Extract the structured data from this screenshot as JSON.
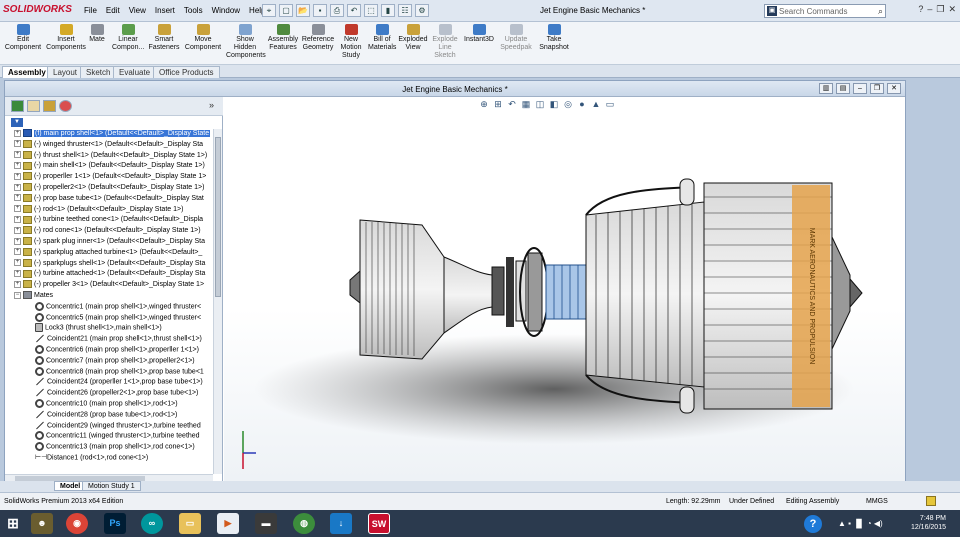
{
  "app": {
    "logo_text": "SOLIDWORKS",
    "document_title": "Jet Engine Basic Mechanics *",
    "search_placeholder": "Search Commands",
    "accent": "#c8102e"
  },
  "menu": [
    "File",
    "Edit",
    "View",
    "Insert",
    "Tools",
    "Window",
    "Help"
  ],
  "quick_access_icons": [
    "pin-icon",
    "new-document-icon",
    "open-icon",
    "save-icon",
    "print-icon",
    "undo-icon",
    "select-icon",
    "rebuild-icon",
    "file-properties-icon",
    "options-icon"
  ],
  "ribbon": [
    {
      "label": "Edit\nComponent",
      "icon": "edit-component-icon",
      "color": "#3e7bc7"
    },
    {
      "label": "Insert\nComponents",
      "icon": "insert-components-icon",
      "color": "#d4a926"
    },
    {
      "label": "Mate",
      "icon": "mate-icon",
      "color": "#8a8f99"
    },
    {
      "label": "Linear\nCompon...",
      "icon": "linear-pattern-icon",
      "color": "#5c9d4b"
    },
    {
      "label": "Smart\nFasteners",
      "icon": "smart-fasteners-icon",
      "color": "#c9a13a"
    },
    {
      "label": "Move\nComponent",
      "icon": "move-component-icon",
      "color": "#c9a13a"
    },
    {
      "label": "Show\nHidden\nComponents",
      "icon": "show-hidden-icon",
      "color": "#7fa3cf"
    },
    {
      "label": "Assembly\nFeatures",
      "icon": "assembly-features-icon",
      "color": "#4f8a3e"
    },
    {
      "label": "Reference\nGeometry",
      "icon": "reference-geometry-icon",
      "color": "#8a8f99"
    },
    {
      "label": "New\nMotion\nStudy",
      "icon": "motion-study-icon",
      "color": "#c0392b"
    },
    {
      "label": "Bill of\nMaterials",
      "icon": "bom-icon",
      "color": "#3e7bc7"
    },
    {
      "label": "Exploded\nView",
      "icon": "exploded-view-icon",
      "color": "#c9a13a"
    },
    {
      "label": "Explode\nLine\nSketch",
      "icon": "explode-line-icon",
      "color": "#b8c0cc"
    },
    {
      "label": "Instant3D",
      "icon": "instant3d-icon",
      "color": "#3e7bc7"
    },
    {
      "label": "Update\nSpeedpak",
      "icon": "speedpak-icon",
      "color": "#b8c0cc"
    },
    {
      "label": "Take\nSnapshot",
      "icon": "snapshot-icon",
      "color": "#3e7bc7"
    }
  ],
  "command_tabs": [
    "Assembly",
    "Layout",
    "Sketch",
    "Evaluate",
    "Office Products"
  ],
  "tree": {
    "components": [
      "(f) main prop shell<1> (Default<<Default>_Display State",
      "(-) winged thruster<1> (Default<<Default>_Display Sta",
      "(-) thrust shell<1> (Default<<Default>_Display State 1>)",
      "(-) main shell<1> (Default<<Default>_Display State 1>)",
      "(-) properller 1<1> (Default<<Default>_Display State 1>",
      "(-) propeller2<1> (Default<<Default>_Display State 1>)",
      "(-) prop base tube<1> (Default<<Default>_Display Stat",
      "(-) rod<1> (Default<<Default>_Display State 1>)",
      "(-) turbine teethed cone<1> (Default<<Default>_Displa",
      "(-) rod cone<1> (Default<<Default>_Display State 1>)",
      "(-) spark plug inner<1> (Default<<Default>_Display Sta",
      "(-) sparkplug attached turbine<1> (Default<<Default>_",
      "(-) sparkplugs shell<1> (Default<<Default>_Display Sta",
      "(-) turbine attached<1> (Default<<Default>_Display Sta",
      "(-) propeller 3<1> (Default<<Default>_Display State 1>"
    ],
    "mates_label": "Mates",
    "mates": [
      {
        "type": "concentric",
        "text": "Concentric1 (main prop shell<1>,winged thruster<"
      },
      {
        "type": "concentric",
        "text": "Concentric5 (main prop shell<1>,winged thruster<"
      },
      {
        "type": "lock",
        "text": "Lock3 (thrust shell<1>,main shell<1>)"
      },
      {
        "type": "coincident",
        "text": "Coincident21 (main prop shell<1>,thrust shell<1>)"
      },
      {
        "type": "concentric",
        "text": "Concentric6 (main prop shell<1>,properller 1<1>)"
      },
      {
        "type": "concentric",
        "text": "Concentric7 (main prop shell<1>,propeller2<1>)"
      },
      {
        "type": "concentric",
        "text": "Concentric8 (main prop shell<1>,prop base tube<1"
      },
      {
        "type": "coincident",
        "text": "Coincident24 (properller 1<1>,prop base tube<1>)"
      },
      {
        "type": "coincident",
        "text": "Coincident26 (propeller2<1>,prop base tube<1>)"
      },
      {
        "type": "concentric",
        "text": "Concentric10 (main prop shell<1>,rod<1>)"
      },
      {
        "type": "coincident",
        "text": "Coincident28 (prop base tube<1>,rod<1>)"
      },
      {
        "type": "coincident",
        "text": "Coincident29 (winged thruster<1>,turbine teethed"
      },
      {
        "type": "concentric",
        "text": "Concentric11 (winged thruster<1>,turbine teethed"
      },
      {
        "type": "concentric",
        "text": "Concentric13 (main prop shell<1>,rod cone<1>)"
      },
      {
        "type": "distance",
        "text": "Distance1 (rod<1>,rod cone<1>)"
      }
    ]
  },
  "model_label_text": "MARK AERONAUTICS AND PROPULSION",
  "bottom_tabs": [
    "Model",
    "Motion Study 1"
  ],
  "status": {
    "edition": "SolidWorks Premium 2013 x64 Edition",
    "length": "Length: 92.29mm",
    "state": "Under Defined",
    "mode": "Editing Assembly",
    "units": "MMGS"
  },
  "taskbar": {
    "time": "7:48 PM",
    "date": "12/16/2015"
  }
}
